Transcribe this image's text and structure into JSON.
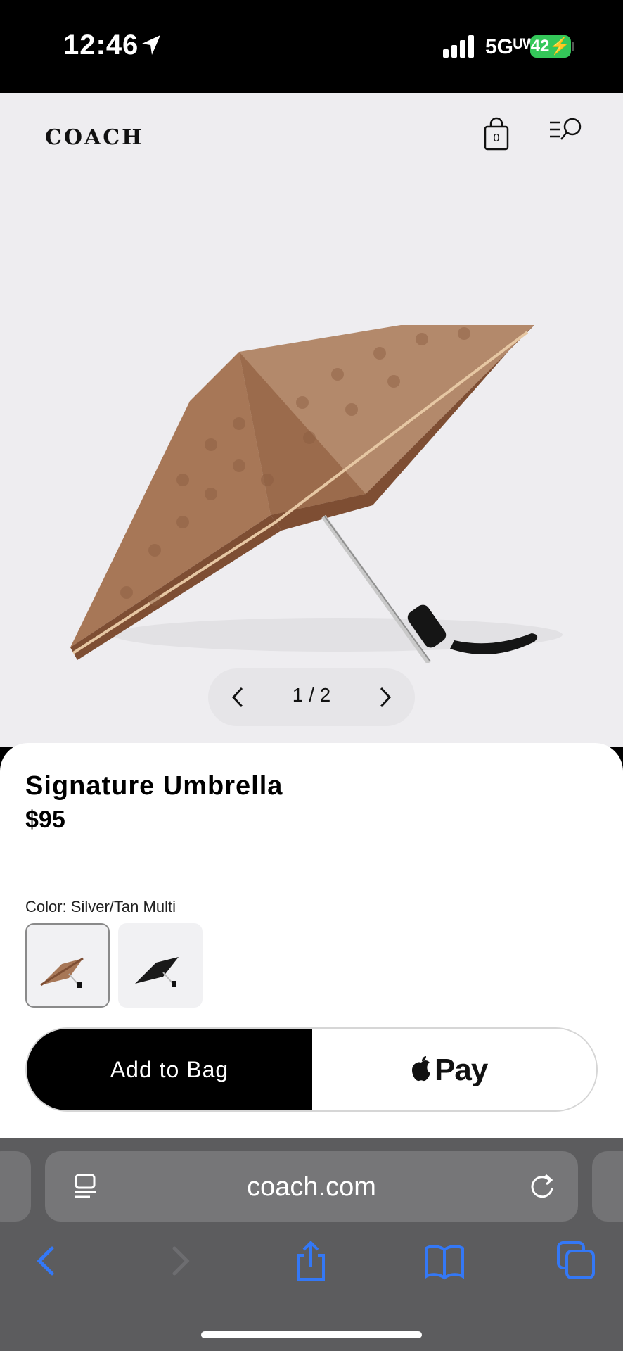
{
  "status_bar": {
    "time": "12:46",
    "network": "5Gᵁᵂ",
    "battery": "42",
    "icons": [
      "location-arrow-icon",
      "cellular-signal-icon",
      "battery-charging-icon"
    ]
  },
  "header": {
    "logo": "COACH",
    "bag_count": "0",
    "icons": [
      "shopping-bag-icon",
      "menu-search-icon"
    ]
  },
  "gallery": {
    "pager_text": "1 / 2",
    "icons": [
      "chevron-left-icon",
      "chevron-right-icon"
    ]
  },
  "product": {
    "title": "Signature Umbrella",
    "price": "$95",
    "color_label": "Color: Silver/Tan Multi",
    "swatches": [
      "Silver/Tan Multi",
      "Black"
    ]
  },
  "actions": {
    "add_to_bag": "Add to Bag",
    "apple_pay": "Pay"
  },
  "browser": {
    "url": "coach.com",
    "toolbar_icons": [
      "back-icon",
      "forward-icon",
      "share-icon",
      "bookmarks-icon",
      "tabs-icon"
    ]
  },
  "colors": {
    "accent": "#3478f6",
    "hero_bg": "#eeedf0",
    "battery": "#34c759",
    "umbrella_tan": "#a77757",
    "umbrella_border": "#7e4e33"
  }
}
